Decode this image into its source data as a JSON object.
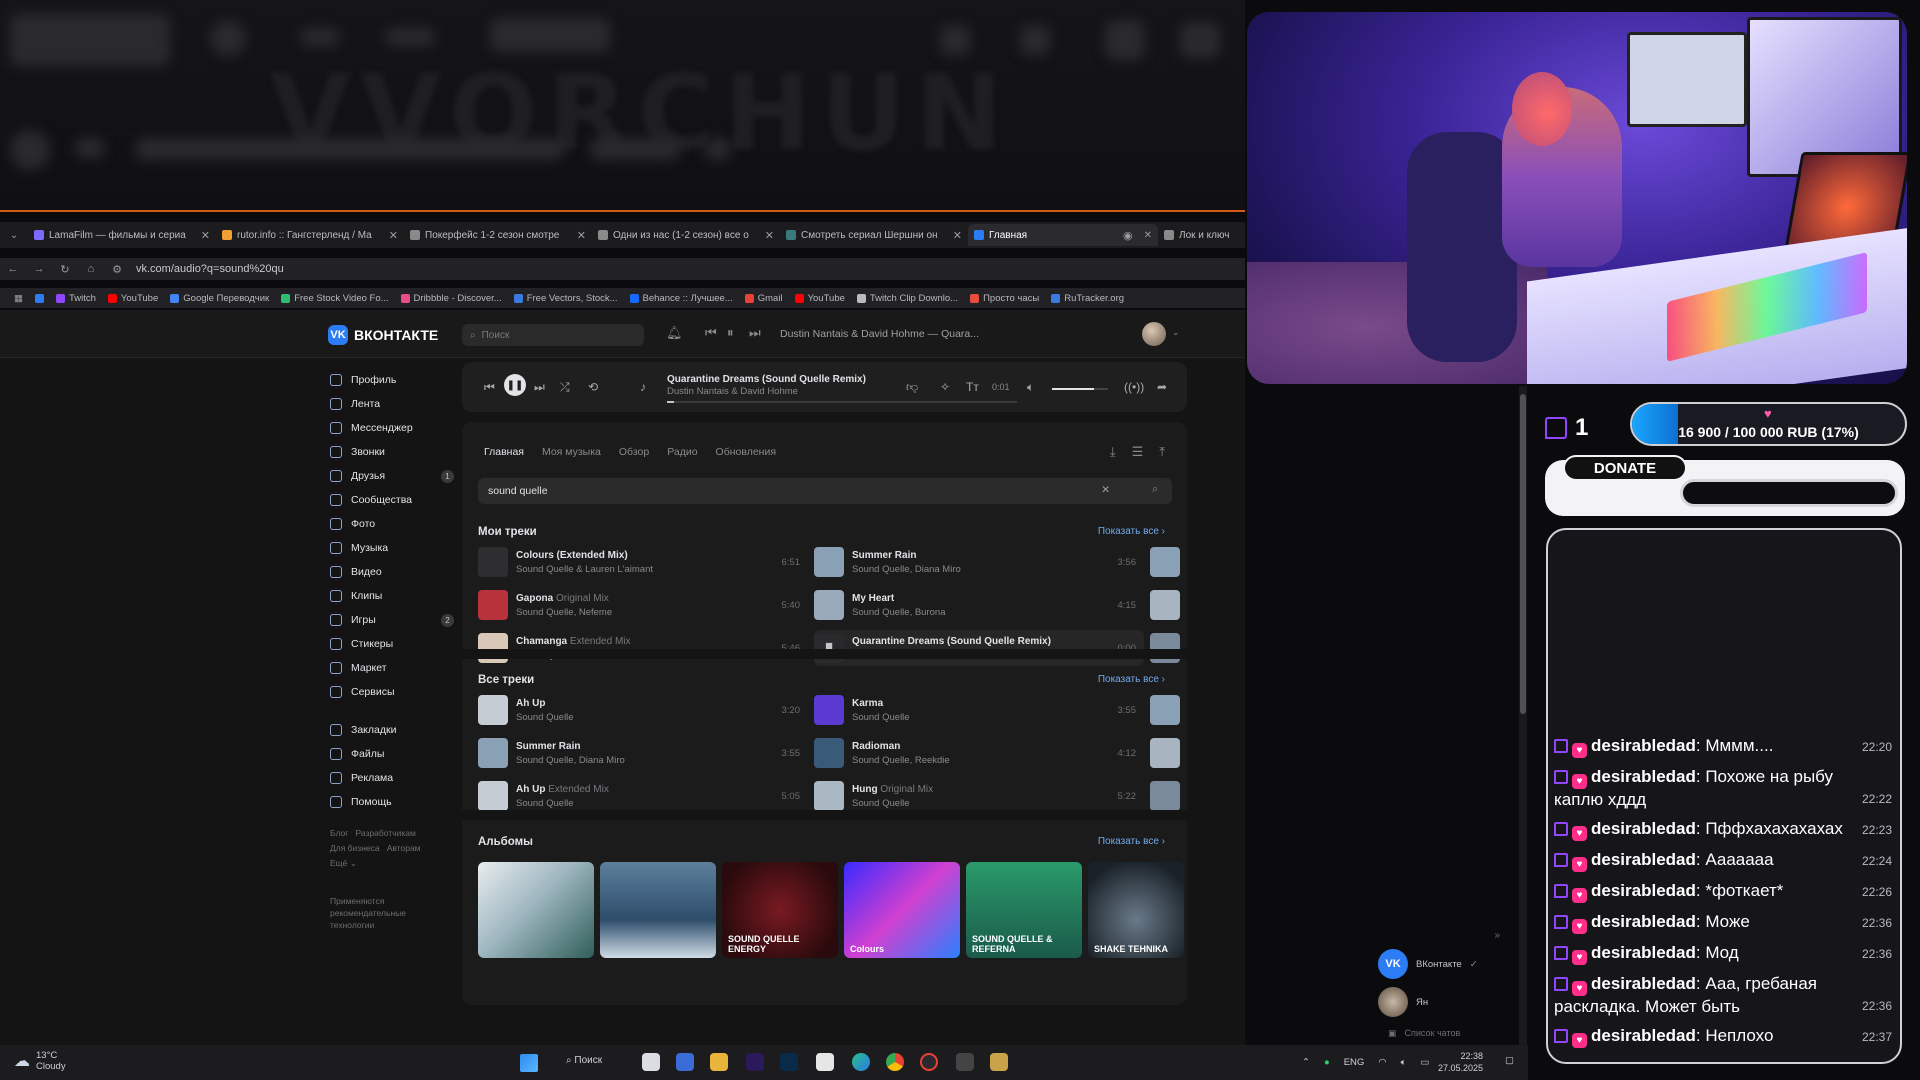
{
  "browser": {
    "tabs": [
      {
        "title": "LamaFilm — фильмы и сериа",
        "color": "#7d6bff"
      },
      {
        "title": "rutor.info :: Гангстерленд / Ма",
        "color": "#f0a032"
      },
      {
        "title": "Покерфейс 1-2 сезон смотре",
        "color": "#8a8a8a"
      },
      {
        "title": "Одни из нас (1-2 сезон) все о",
        "color": "#8a8a8a"
      },
      {
        "title": "Смотреть сериал Шершни он",
        "color": "#3a7a7a"
      },
      {
        "title": "Главная",
        "color": "#2c7cf6"
      },
      {
        "title": "Лок и ключ",
        "color": "#8a8a8a"
      }
    ],
    "url": "vk.com/audio?q=sound%20qu",
    "bookmarks": [
      {
        "label": "Twitch",
        "color": "#9146ff"
      },
      {
        "label": "YouTube",
        "color": "#ff0000"
      },
      {
        "label": "Google Переводчик",
        "color": "#4285f4"
      },
      {
        "label": "Free Stock Video Fo...",
        "color": "#2fbf71"
      },
      {
        "label": "Dribbble - Discover...",
        "color": "#ea4c89"
      },
      {
        "label": "Free Vectors, Stock...",
        "color": "#3b7be0"
      },
      {
        "label": "Behance :: Лучшее...",
        "color": "#1769ff"
      },
      {
        "label": "Gmail",
        "color": "#e94235"
      },
      {
        "label": "YouTube",
        "color": "#ff0000"
      },
      {
        "label": "Twitch Clip Downlo...",
        "color": "#bbbbbb"
      },
      {
        "label": "Просто часы",
        "color": "#e74c3c"
      },
      {
        "label": "RuTracker.org",
        "color": "#3b7be0"
      }
    ]
  },
  "vk": {
    "logo": "ВКОНТАКТЕ",
    "search_placeholder": "Поиск",
    "header_track": "Dustin Nantais & David Hohme — Quara...",
    "nav": [
      {
        "label": "Профиль",
        "badge": ""
      },
      {
        "label": "Лента",
        "badge": ""
      },
      {
        "label": "Мессенджер",
        "badge": ""
      },
      {
        "label": "Звонки",
        "badge": ""
      },
      {
        "label": "Друзья",
        "badge": "1"
      },
      {
        "label": "Сообщества",
        "badge": ""
      },
      {
        "label": "Фото",
        "badge": ""
      },
      {
        "label": "Музыка",
        "badge": ""
      },
      {
        "label": "Видео",
        "badge": ""
      },
      {
        "label": "Клипы",
        "badge": ""
      },
      {
        "label": "Игры",
        "badge": "2"
      },
      {
        "label": "Стикеры",
        "badge": ""
      },
      {
        "label": "Маркет",
        "badge": ""
      },
      {
        "label": "Сервисы",
        "badge": ""
      }
    ],
    "nav2": [
      "Закладки",
      "Файлы",
      "Реклама",
      "Помощь"
    ],
    "footer_links": [
      "Блог",
      "Разработчикам",
      "Для бизнеса",
      "Авторам",
      "Ещё"
    ],
    "footer_note": "Применяются рекомендательные технологии",
    "player": {
      "title": "Quarantine Dreams (Sound Quelle Remix)",
      "artist": "Dustin Nantais & David Hohme",
      "time": "0:01",
      "progress": 0.02,
      "volume": 0.75
    },
    "music_tabs": [
      "Главная",
      "Моя музыка",
      "Обзор",
      "Радио",
      "Обновления"
    ],
    "search_query": "sound quelle",
    "my_tracks_title": "Мои треки",
    "all_tracks_title": "Все треки",
    "albums_title": "Альбомы",
    "show_all": "Показать все",
    "my_tracks": [
      {
        "title": "Colours (Extended Mix)",
        "sub": "",
        "artist": "Sound Quelle & Lauren L'aimant",
        "dur": "6:51",
        "color": "#2e2e30"
      },
      {
        "title": "Summer Rain",
        "sub": "",
        "artist": "Sound Quelle, Diana Miro",
        "dur": "3:56",
        "color": "#8aa0b4"
      },
      {
        "title": "Gapona",
        "sub": "Original Mix",
        "artist": "Sound Quelle, Nefeme",
        "dur": "5:40",
        "color": "#b8323c"
      },
      {
        "title": "My Heart",
        "sub": "",
        "artist": "Sound Quelle, Burona",
        "dur": "4:15",
        "color": "#9aaabb"
      },
      {
        "title": "Chamanga",
        "sub": "Extended Mix",
        "artist": "Sound Quelle",
        "dur": "5:46",
        "color": "#d9c8b8"
      },
      {
        "title": "Quarantine Dreams (Sound Quelle Remix)",
        "sub": "",
        "artist": "Dustin Nantais & David Hohme",
        "dur": "0:00",
        "color": "#2a2a2c"
      }
    ],
    "all_tracks": [
      {
        "title": "Ah Up",
        "sub": "",
        "artist": "Sound Quelle",
        "dur": "3:20",
        "color": "#c5ccd4"
      },
      {
        "title": "Karma",
        "sub": "",
        "artist": "Sound Quelle",
        "dur": "3:55",
        "color": "#5a3ad0"
      },
      {
        "title": "Summer Rain",
        "sub": "",
        "artist": "Sound Quelle, Diana Miro",
        "dur": "3:55",
        "color": "#8aa0b4"
      },
      {
        "title": "Radioman",
        "sub": "",
        "artist": "Sound Quelle, Reekdie",
        "dur": "4:12",
        "color": "#3a5a7a"
      },
      {
        "title": "Ah Up",
        "sub": "Extended Mix",
        "artist": "Sound Quelle",
        "dur": "5:05",
        "color": "#c5ccd4"
      },
      {
        "title": "Hung",
        "sub": "Original Mix",
        "artist": "Sound Quelle",
        "dur": "5:22",
        "color": "#aab8c4"
      }
    ],
    "albums": [
      {
        "label": "",
        "bg": "linear-gradient(135deg,#e8ecef 0%,#9fb7c0 45%,#2f5f5a 100%)"
      },
      {
        "label": "",
        "bg": "linear-gradient(180deg,#5d7f9c 0%,#2d4d6b 60%,#cfdbe6 100%)"
      },
      {
        "label": "SOUND QUELLE ENERGY",
        "bg": "radial-gradient(circle at 50% 50%,#7a1a22 0%,#2a0a0c 80%)"
      },
      {
        "label": "Colours",
        "bg": "linear-gradient(135deg,#3a2aff 0%,#d040d0 50%,#2a80ff 100%)"
      },
      {
        "label": "SOUND QUELLE & REFERNA",
        "bg": "linear-gradient(180deg,#2a9a6a 0%,#1a5a4a 100%)"
      },
      {
        "label": "SHAKE TEHNIKA",
        "bg": "radial-gradient(circle at 50% 60%,#6a7a8a 0%,#1a2228 80%)"
      }
    ]
  },
  "vk_widget": {
    "items": [
      "ВКонтакте",
      "Ян",
      "Список чатов"
    ]
  },
  "taskbar": {
    "weather_temp": "13°C",
    "weather_desc": "Cloudy",
    "search": "Поиск",
    "lang": "ENG",
    "time": "22:38",
    "date": "27.05.2025"
  },
  "stream": {
    "follow_count": "1",
    "goal_text": "16 900 / 100 000 RUB (17%)",
    "goal_progress": 0.17,
    "donate_label": "DONATE",
    "chat": [
      {
        "user": "desirabledad",
        "text": "Мммм....",
        "ts": "22:20"
      },
      {
        "user": "desirabledad",
        "text": "Похоже на рыбу каплю хддд",
        "ts": "22:22"
      },
      {
        "user": "desirabledad",
        "text": "Пффхахахахахах",
        "ts": "22:23"
      },
      {
        "user": "desirabledad",
        "text": "Аааааaa",
        "ts": "22:24"
      },
      {
        "user": "desirabledad",
        "text": "*фоткает*",
        "ts": "22:26"
      },
      {
        "user": "desirabledad",
        "text": "Може",
        "ts": "22:36"
      },
      {
        "user": "desirabledad",
        "text": "Мод",
        "ts": "22:36"
      },
      {
        "user": "desirabledad",
        "text": "Ааа, гребаная раскладка. Может быть",
        "ts": "22:36"
      },
      {
        "user": "desirabledad",
        "text": "Неплохо",
        "ts": "22:37"
      }
    ]
  }
}
